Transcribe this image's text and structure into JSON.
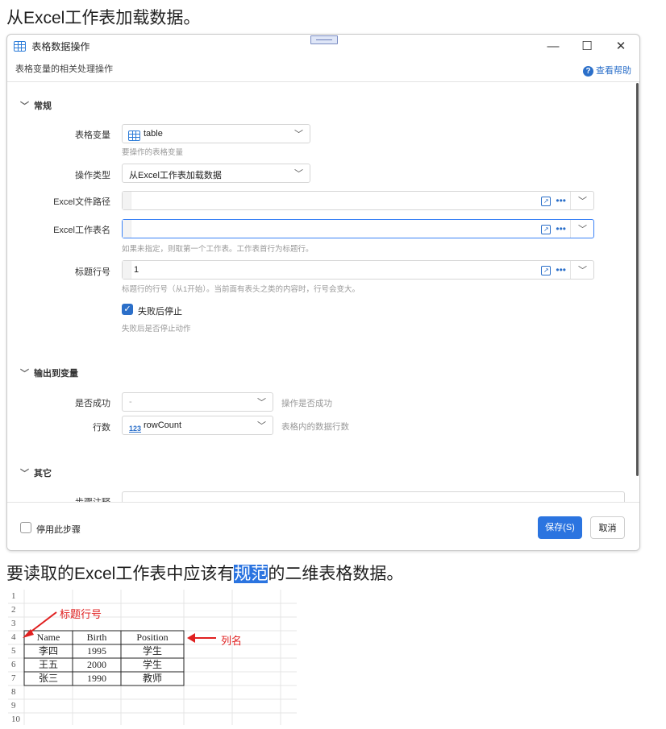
{
  "heading_top": "从Excel工作表加载数据。",
  "dialog": {
    "title": "表格数据操作",
    "subtitle": "表格变量的相关处理操作",
    "help": "查看帮助",
    "controls": {
      "minimize": "—",
      "maximize": "☐",
      "close": "✕"
    },
    "sections": {
      "general": "常规",
      "output": "输出到变量",
      "other": "其它"
    },
    "fields": {
      "table_var": {
        "label": "表格变量",
        "value": "table",
        "hint": "要操作的表格变量"
      },
      "op_type": {
        "label": "操作类型",
        "value": "从Excel工作表加载数据"
      },
      "excel_path": {
        "label": "Excel文件路径",
        "value": ""
      },
      "excel_sheet": {
        "label": "Excel工作表名",
        "value": "",
        "hint": "如果未指定，则取第一个工作表。工作表首行为标题行。"
      },
      "header_row": {
        "label": "标题行号",
        "value": "1",
        "hint": "标题行的行号（从1开始）。当前面有表头之类的内容时，行号会变大。"
      },
      "stop_on_fail": {
        "label": "失败后停止",
        "hint": "失败后是否停止动作",
        "checked": true
      },
      "success": {
        "label": "是否成功",
        "value": "-",
        "hint": "操作是否成功"
      },
      "row_count": {
        "label": "行数",
        "value": "rowCount",
        "hint": "表格内的数据行数",
        "icon_text": "123"
      },
      "step_note": {
        "label": "步骤注释"
      }
    },
    "footer": {
      "disable_label": "停用此步骤",
      "save": "保存(S)",
      "cancel": "取消"
    }
  },
  "heading_bottom": {
    "before": "要读取的Excel工作表中应该有",
    "highlight": "规范",
    "after": "的二维表格数据。"
  },
  "sheet": {
    "row_numbers": [
      "1",
      "2",
      "3",
      "4",
      "5",
      "6",
      "7",
      "8",
      "9",
      "10"
    ],
    "columns": [
      "Name",
      "Birth",
      "Position"
    ],
    "rows": [
      [
        "李四",
        "1995",
        "学生"
      ],
      [
        "王五",
        "2000",
        "学生"
      ],
      [
        "张三",
        "1990",
        "教师"
      ]
    ],
    "annotations": {
      "header_row": "标题行号",
      "column_names": "列名"
    }
  }
}
